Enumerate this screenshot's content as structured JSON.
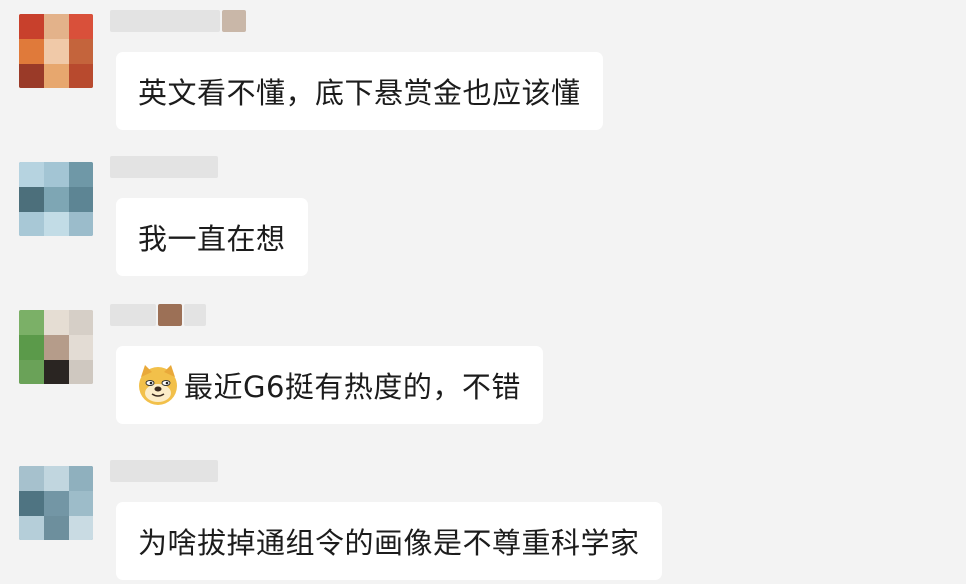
{
  "messages": [
    {
      "sender_blurred": true,
      "text": "英文看不懂，底下悬赏金也应该懂"
    },
    {
      "sender_blurred": true,
      "text": "我一直在想"
    },
    {
      "sender_blurred": true,
      "emoji": "doge-emoji",
      "text": "最近G6挺有热度的，不错"
    },
    {
      "sender_blurred": true,
      "text": "为啥拔掉通组令的画像是不尊重科学家"
    }
  ],
  "colors": {
    "background": "#f3f3f3",
    "bubble": "#ffffff",
    "text": "#1c1c1c"
  }
}
